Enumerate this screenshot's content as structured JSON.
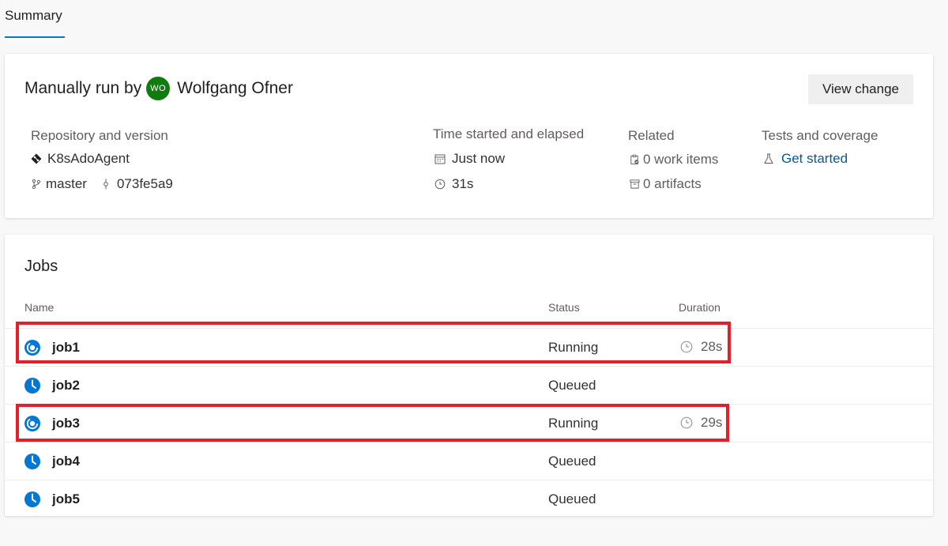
{
  "tabs": [
    {
      "label": "Summary"
    }
  ],
  "summary": {
    "run_by_prefix": "Manually run by",
    "user_initials": "WO",
    "user_name": "Wolfgang Ofner",
    "view_change_label": "View change",
    "repo": {
      "label": "Repository and version",
      "name": "K8sAdoAgent",
      "branch": "master",
      "commit": "073fe5a9"
    },
    "time": {
      "label": "Time started and elapsed",
      "started": "Just now",
      "elapsed": "31s"
    },
    "related": {
      "label": "Related",
      "work_items": "0 work items",
      "artifacts": "0 artifacts"
    },
    "tests": {
      "label": "Tests and coverage",
      "link": "Get started"
    }
  },
  "jobs": {
    "title": "Jobs",
    "columns": {
      "name": "Name",
      "status": "Status",
      "duration": "Duration"
    },
    "rows": [
      {
        "name": "job1",
        "status": "Running",
        "duration": "28s",
        "icon": "running-icon",
        "highlighted": true
      },
      {
        "name": "job2",
        "status": "Queued",
        "duration": "",
        "icon": "queued-clock-icon",
        "highlighted": false
      },
      {
        "name": "job3",
        "status": "Running",
        "duration": "29s",
        "icon": "running-icon",
        "highlighted": true
      },
      {
        "name": "job4",
        "status": "Queued",
        "duration": "",
        "icon": "queued-clock-icon",
        "highlighted": false
      },
      {
        "name": "job5",
        "status": "Queued",
        "duration": "",
        "icon": "queued-clock-icon",
        "highlighted": false
      }
    ]
  },
  "colors": {
    "accent": "#0078d4",
    "avatar": "#107c10",
    "highlight": "#e3202a",
    "link": "#005a9e"
  }
}
